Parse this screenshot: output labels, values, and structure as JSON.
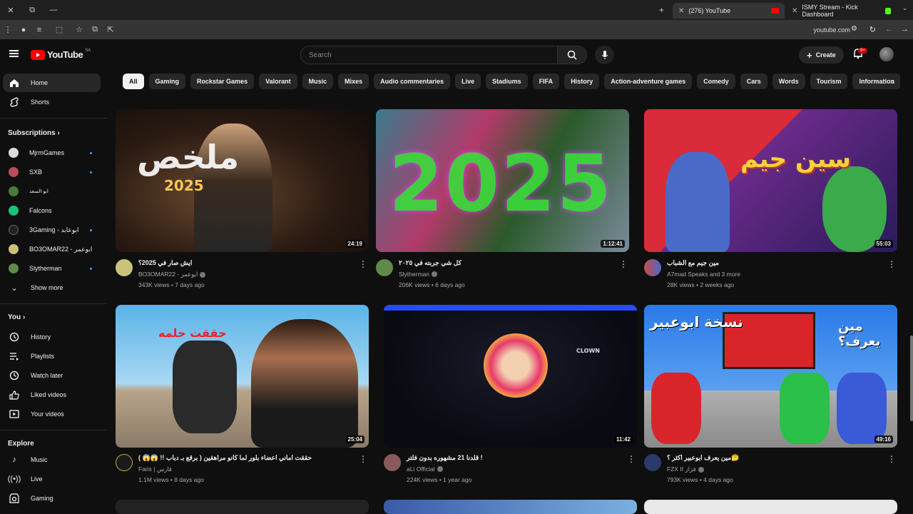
{
  "browser": {
    "tabs": [
      {
        "title": "(276) YouTube"
      },
      {
        "title": "ISMY Stream - Kick Dashboard"
      }
    ],
    "url": "youtube.com"
  },
  "masthead": {
    "logo": "YouTube",
    "country": "SA",
    "search_placeholder": "Search",
    "create_label": "Create",
    "notif_count": "9+"
  },
  "sidebar": {
    "main": [
      {
        "label": "Home",
        "icon": "home-icon"
      },
      {
        "label": "Shorts",
        "icon": "shorts-icon"
      }
    ],
    "subscriptions_title": "Subscriptions",
    "subscriptions": [
      {
        "label": "MjrmGames"
      },
      {
        "label": "SXB"
      },
      {
        "label": "ابو السعد"
      },
      {
        "label": "Falcons"
      },
      {
        "label": "3Gaming - ابوعابد"
      },
      {
        "label": "BO3OMAR22 - ابوعمر"
      },
      {
        "label": "Slytherman"
      }
    ],
    "show_more": "Show more",
    "you_title": "You",
    "you": [
      {
        "label": "History",
        "icon": "history-icon"
      },
      {
        "label": "Playlists",
        "icon": "playlists-icon"
      },
      {
        "label": "Watch later",
        "icon": "watch-later-icon"
      },
      {
        "label": "Liked videos",
        "icon": "like-icon"
      },
      {
        "label": "Your videos",
        "icon": "your-videos-icon"
      }
    ],
    "explore_title": "Explore",
    "explore": [
      {
        "label": "Music",
        "icon": "music-icon"
      },
      {
        "label": "Live",
        "icon": "live-icon"
      },
      {
        "label": "Gaming",
        "icon": "gaming-icon"
      }
    ]
  },
  "chips": [
    "All",
    "Gaming",
    "Rockstar Games",
    "Valorant",
    "Music",
    "Mixes",
    "Audio commentaries",
    "Live",
    "Stadiums",
    "FIFA",
    "History",
    "Action-adventure games",
    "Comedy",
    "Cars",
    "Words",
    "Tourism",
    "Information"
  ],
  "videos": [
    {
      "title": "ايش صار في 2025؟",
      "channel": "BO3OMAR22 - ابوعمر",
      "stats": "343K views • 7 days ago",
      "duration": "24:19",
      "overlay": "ملخص",
      "overlay2": "2025"
    },
    {
      "title": "كل شي جربته في ٢٠٢٥",
      "channel": "Slytherman",
      "stats": "206K views • 6 days ago",
      "duration": "1:12:41",
      "overlay": "2025"
    },
    {
      "title": "مين جيم مع الشباب",
      "channel": "A7mad Speaks and 3 more",
      "stats": "28K views • 2 weeks ago",
      "duration": "55:03",
      "overlay": "سين جيم"
    },
    {
      "title": "حققت اماني اعضاء بلور لما كانو مراهقين ( برقع بـ دباب !! 😱😱 )",
      "channel": "Faris | فارس",
      "stats": "1.1M views • 8 days ago",
      "duration": "25:04",
      "overlay": "حققت حلمه"
    },
    {
      "title": "قلدنا 21 مشهوره بدون فلتر !",
      "channel": "aLi Official",
      "stats": "224K views • 1 year ago",
      "duration": "11:42",
      "overlay": "CLOWN"
    },
    {
      "title": "مين يعرف ابوعبير اكثر ؟🤔",
      "channel": "FZX II فزاز",
      "stats": "793K views • 4 days ago",
      "duration": "49:16",
      "overlay": "مين يعرف؟",
      "overlay2": "نسخة ابوعبير"
    }
  ]
}
